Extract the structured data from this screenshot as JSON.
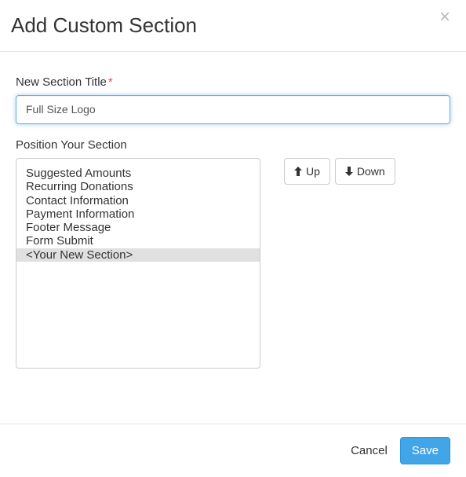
{
  "header": {
    "title": "Add Custom Section"
  },
  "form": {
    "title_label": "New Section Title",
    "title_value": "Full Size Logo",
    "position_label": "Position Your Section"
  },
  "sections": [
    {
      "label": "Suggested Amounts",
      "selected": false
    },
    {
      "label": "Recurring Donations",
      "selected": false
    },
    {
      "label": "Contact Information",
      "selected": false
    },
    {
      "label": "Payment Information",
      "selected": false
    },
    {
      "label": "Footer Message",
      "selected": false
    },
    {
      "label": "Form Submit",
      "selected": false
    },
    {
      "label": "<Your New Section>",
      "selected": true
    }
  ],
  "buttons": {
    "up": "Up",
    "down": "Down",
    "cancel": "Cancel",
    "save": "Save"
  }
}
